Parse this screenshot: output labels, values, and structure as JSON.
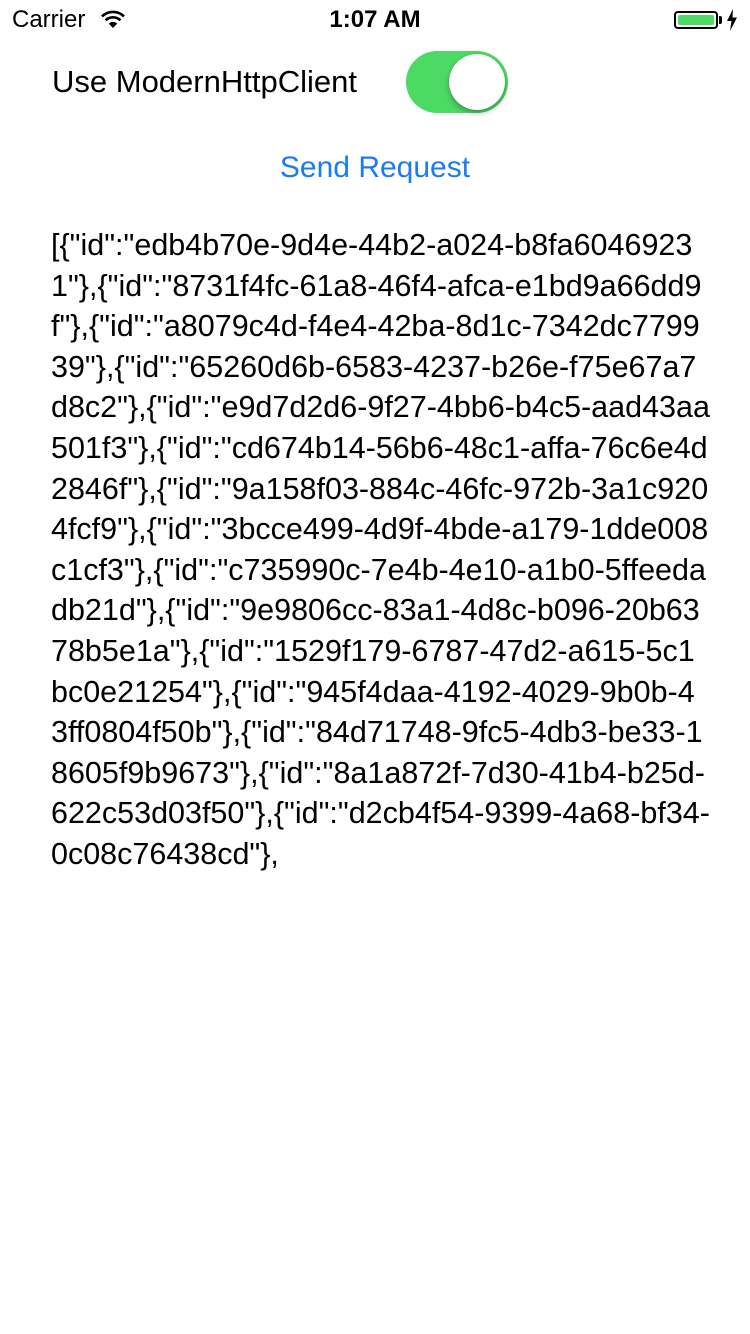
{
  "status_bar": {
    "carrier": "Carrier",
    "time": "1:07 AM",
    "battery_color": "#4cd964"
  },
  "toggle": {
    "label": "Use ModernHttpClient",
    "on": true,
    "on_color": "#4cd964"
  },
  "send_button": {
    "label": "Send Request",
    "color": "#1a7cf5"
  },
  "response": {
    "text": "[{\"id\":\"edb4b70e-9d4e-44b2-a024-b8fa60469231\"},{\"id\":\"8731f4fc-61a8-46f4-afca-e1bd9a66dd9f\"},{\"id\":\"a8079c4d-f4e4-42ba-8d1c-7342dc779939\"},{\"id\":\"65260d6b-6583-4237-b26e-f75e67a7d8c2\"},{\"id\":\"e9d7d2d6-9f27-4bb6-b4c5-aad43aa501f3\"},{\"id\":\"cd674b14-56b6-48c1-affa-76c6e4d2846f\"},{\"id\":\"9a158f03-884c-46fc-972b-3a1c9204fcf9\"},{\"id\":\"3bcce499-4d9f-4bde-a179-1dde008c1cf3\"},{\"id\":\"c735990c-7e4b-4e10-a1b0-5ffeedadb21d\"},{\"id\":\"9e9806cc-83a1-4d8c-b096-20b6378b5e1a\"},{\"id\":\"1529f179-6787-47d2-a615-5c1bc0e21254\"},{\"id\":\"945f4daa-4192-4029-9b0b-43ff0804f50b\"},{\"id\":\"84d71748-9fc5-4db3-be33-18605f9b9673\"},{\"id\":\"8a1a872f-7d30-41b4-b25d-622c53d03f50\"},{\"id\":\"d2cb4f54-9399-4a68-bf34-0c08c76438cd\"},"
  }
}
